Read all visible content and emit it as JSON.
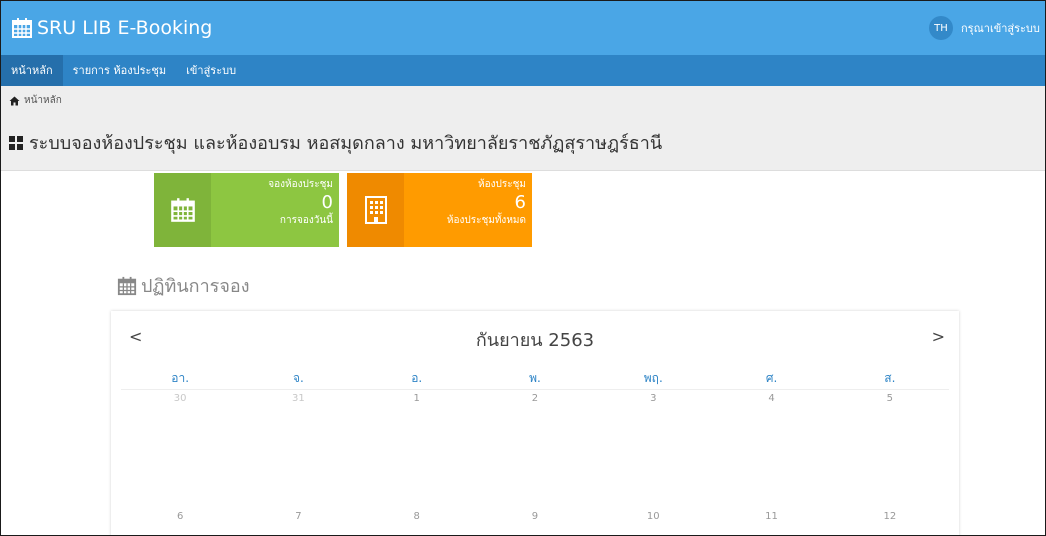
{
  "app": {
    "title": "SRU LIB E-Booking"
  },
  "user": {
    "initials": "TH",
    "login_prompt": "กรุณาเข้าสู่ระบบ"
  },
  "nav": {
    "items": [
      {
        "label": "หน้าหลัก"
      },
      {
        "label": "รายการ ห้องประชุม"
      },
      {
        "label": "เข้าสู่ระบบ"
      }
    ]
  },
  "breadcrumb": {
    "home": "หน้าหลัก"
  },
  "page": {
    "title": "ระบบจองห้องประชุม และห้องอบรม หอสมุดกลาง มหาวิทยาลัยราชภัฏสุราษฎร์ธานี"
  },
  "stats": {
    "bookings": {
      "label": "จองห้องประชุม",
      "value": "0",
      "sublabel": "การจองวันนี้"
    },
    "rooms": {
      "label": "ห้องประชุม",
      "value": "6",
      "sublabel": "ห้องประชุมทั้งหมด"
    }
  },
  "schedule": {
    "heading": "ปฏิทินการจอง"
  },
  "calendar": {
    "prev": "<",
    "next": ">",
    "month": "กันยายน 2563",
    "weekdays": [
      "อา.",
      "จ.",
      "อ.",
      "พ.",
      "พฤ.",
      "ศ.",
      "ส."
    ],
    "weeks": [
      [
        "30",
        "31",
        "1",
        "2",
        "3",
        "4",
        "5"
      ],
      [
        "6",
        "7",
        "8",
        "9",
        "10",
        "11",
        "12"
      ]
    ]
  },
  "colors": {
    "topbar": "#4aa6e6",
    "navbar": "#2e84c6",
    "green_card": "#8dc641",
    "orange_card": "#ff9b00",
    "weekday_text": "#2e84c6"
  },
  "icons": {
    "brand": "calendar-icon",
    "breadcrumb": "home-icon",
    "title": "grid-icon",
    "bookings": "calendar-icon",
    "rooms": "building-icon",
    "schedule": "calendar-icon"
  }
}
